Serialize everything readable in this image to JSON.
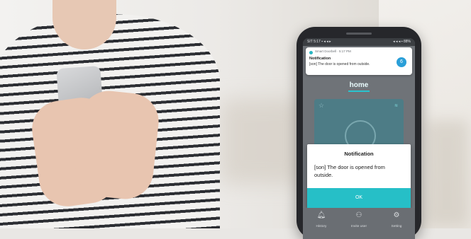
{
  "phone": {
    "statusbar": {
      "time": "SIT 5:17 ▪ ◂ ◂ ▸",
      "right": "◂ ◂ ◂ ▪ 88%"
    },
    "push_notification": {
      "app_name": "Smart Doorbell · 5:17 PM",
      "title": "Notification",
      "body": "[son] The door is opened from outside.",
      "badge": "6"
    },
    "app": {
      "header_title": "home",
      "device_card": {
        "star_icon": "☆",
        "wifi_icon": "≋"
      }
    },
    "dialog": {
      "title": "Notification",
      "body": "[son] The door is opened from outside.",
      "ok_label": "OK"
    },
    "bottom_nav": [
      {
        "icon": "bell-icon",
        "glyph": "🔔︎",
        "label": "History"
      },
      {
        "icon": "user-icon",
        "glyph": "⚇",
        "label": "Invite user"
      },
      {
        "icon": "gear-icon",
        "glyph": "⚙",
        "label": "Setting"
      }
    ],
    "colors": {
      "accent": "#26bfc7",
      "screen": "#6f7378",
      "badge": "#2a9fd8"
    }
  }
}
